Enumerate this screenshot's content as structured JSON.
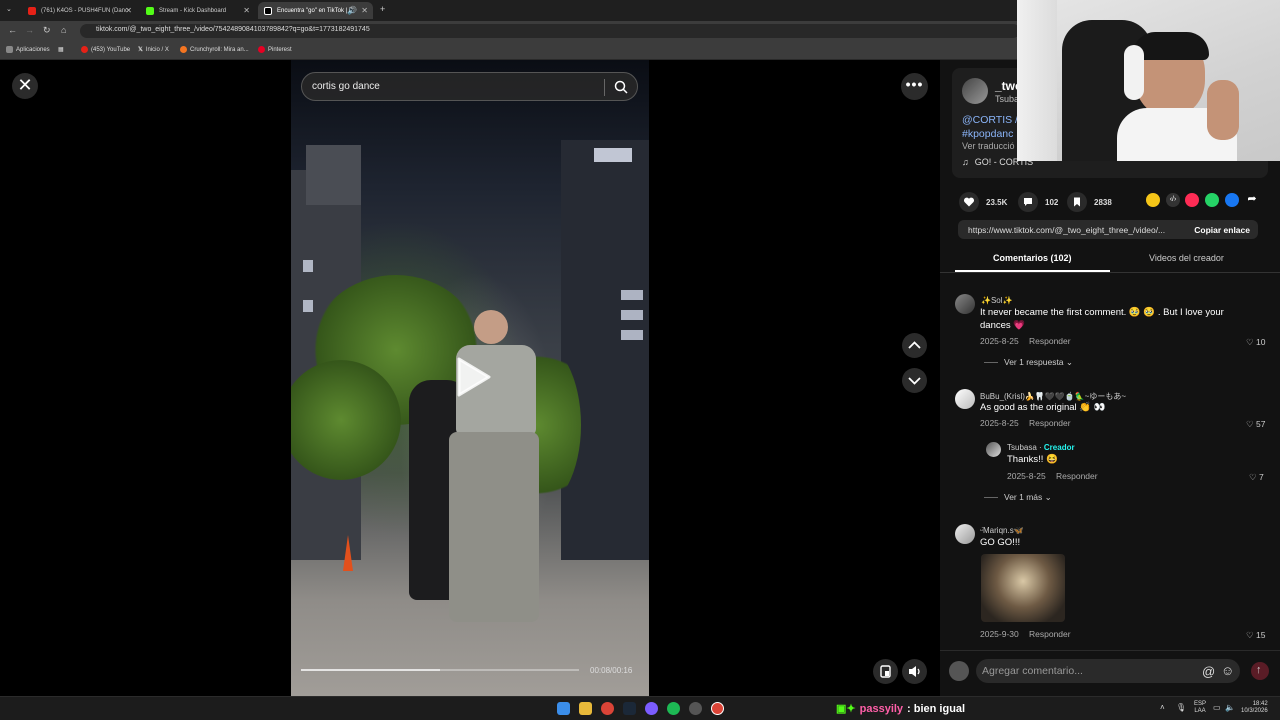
{
  "browser": {
    "tabs": [
      {
        "label": "(761) K4OS - PUSH4FUN (Danc",
        "fav_color": "#e62117"
      },
      {
        "label": "Stream - Kick Dashboard",
        "fav_color": "#53fc18"
      },
      {
        "label": "Encuentra \"go\" en TikTok | B",
        "fav_color": "#ffffff"
      }
    ],
    "url": "tiktok.com/@_two_eight_three_/video/7542489084103789842?q=go&t=1773182491745",
    "bookmarks": [
      {
        "label": "Aplicaciones",
        "color": "#888888"
      },
      {
        "label": "(453) YouTube",
        "color": "#e62117"
      },
      {
        "label": "Inicio / X",
        "color": "#ffffff"
      },
      {
        "label": "Crunchyroll: Mira an...",
        "color": "#f47521"
      },
      {
        "label": "Pinterest",
        "color": "#e60023"
      }
    ]
  },
  "video": {
    "search_text": "cortis go dance",
    "progress_fraction": 0.5,
    "time": "00:08/00:16"
  },
  "author": {
    "name": "_twc",
    "nickname": "Tsuba",
    "desc_line1": "@CORTIS /",
    "desc_line2": "#kpopdanc",
    "translate": "Ver traducció",
    "music": "GO! - CORTIS"
  },
  "stats": {
    "likes": "23.5K",
    "comments": "102",
    "saves": "2838"
  },
  "share": {
    "url": "https://www.tiktok.com/@_two_eight_three_/video/...",
    "copy_label": "Copiar enlace"
  },
  "panel_tabs": {
    "comments": "Comentarios (102)",
    "creator_videos": "Videos del creador"
  },
  "comments": [
    {
      "user": "✨Sol✨",
      "text": "It never became the first comment. 🥹 🥹 . But I love your dances 💗",
      "date": "2025-8-25",
      "reply": "Responder",
      "likes": "10",
      "more": "Ver 1 respuesta"
    },
    {
      "user": "BuBu_(Krisl)🍌🦷🖤🖤🍵🦜~ゆーもあ~",
      "text": "As good as the original 👏 👀",
      "date": "2025-8-25",
      "reply": "Responder",
      "likes": "57"
    },
    {
      "user": "Tsubasa",
      "creator_tag": "Creador",
      "text": "Thanks!! 😆",
      "date": "2025-8-25",
      "reply": "Responder",
      "likes": "7",
      "more": "Ver 1 más"
    },
    {
      "user": "ᵕ̈Mariqn.s🦋",
      "text": "GO GO!!!",
      "date": "2025-9-30",
      "reply": "Responder",
      "likes": "15"
    }
  ],
  "comment_input_placeholder": "Agregar comentario...",
  "taskbar": {
    "overlay_user": "passyily",
    "overlay_msg": ": bien igual",
    "lang": "ESP",
    "lang2": "LAA",
    "time": "18:42",
    "date": "10/3/2026"
  },
  "colors": {
    "accent_link": "#8ab4f8",
    "creator_tag": "#25f4ee",
    "like_red": "#fe2c55"
  }
}
